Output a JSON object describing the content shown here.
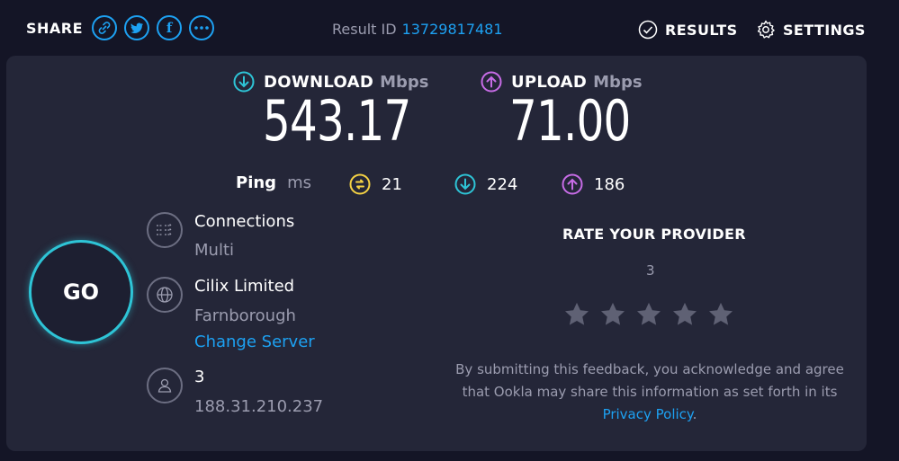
{
  "header": {
    "share_label": "SHARE",
    "share_buttons": [
      "link-icon",
      "twitter-icon",
      "facebook-icon",
      "more-icon"
    ],
    "facebook_glyph": "f",
    "result_id_label": "Result ID",
    "result_id_value": "13729817481",
    "results_label": "RESULTS",
    "settings_label": "SETTINGS"
  },
  "download": {
    "label": "DOWNLOAD",
    "unit": "Mbps",
    "value": "543.17",
    "color": "#2ec4d6"
  },
  "upload": {
    "label": "UPLOAD",
    "unit": "Mbps",
    "value": "71.00",
    "color": "#c76ce6"
  },
  "ping": {
    "label": "Ping",
    "unit": "ms",
    "idle": "21",
    "download": "224",
    "upload": "186",
    "idle_color": "#f4d144"
  },
  "go_button": {
    "label": "GO",
    "ring_color": "#2ec4d6"
  },
  "connections": {
    "title": "Connections",
    "value": "Multi"
  },
  "server": {
    "provider": "Cilix Limited",
    "location": "Farnborough",
    "change_label": "Change Server"
  },
  "user": {
    "name": "3",
    "ip": "188.31.210.237"
  },
  "rating": {
    "title": "RATE YOUR PROVIDER",
    "value_text": "3",
    "max_stars": 5,
    "star_color": "#5f6174",
    "disclaimer_text": "By submitting this feedback, you acknowledge and agree that Ookla may share this information as set forth in its",
    "privacy_link": "Privacy Policy",
    "disclaimer_end": "."
  }
}
